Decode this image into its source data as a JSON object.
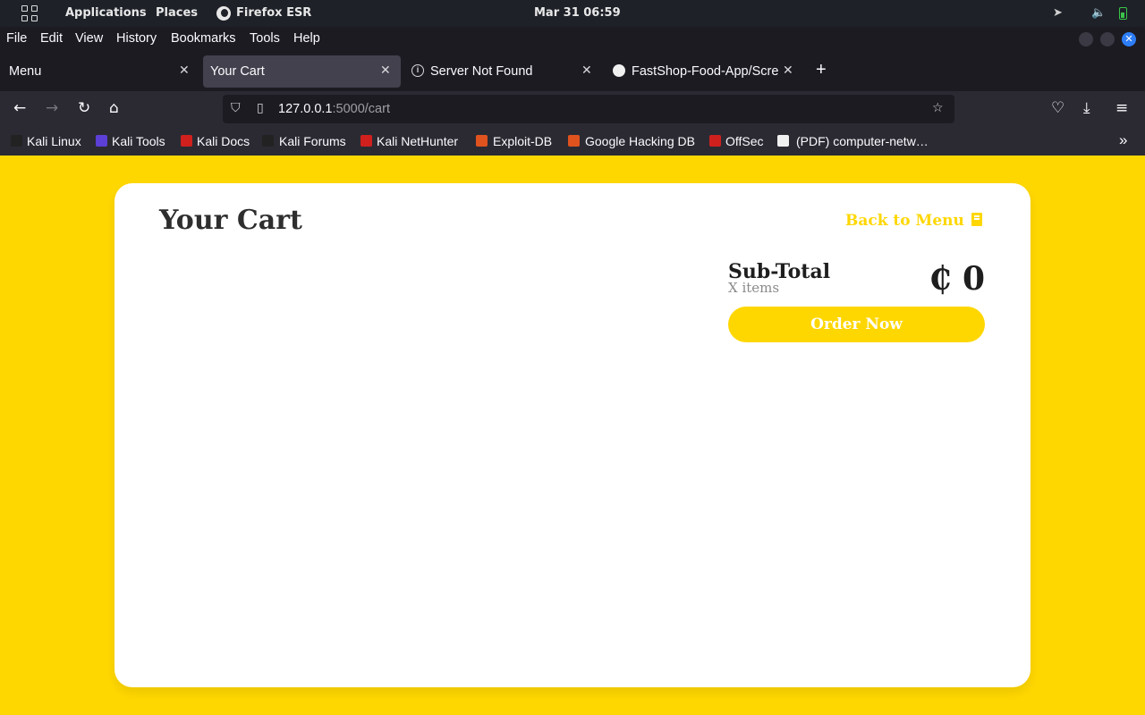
{
  "topbar": {
    "applications": "Applications",
    "places": "Places",
    "browser": "Firefox ESR",
    "clock": "Mar 31  06:59"
  },
  "menubar": {
    "items": [
      "File",
      "Edit",
      "View",
      "History",
      "Bookmarks",
      "Tools",
      "Help"
    ]
  },
  "tabs": [
    {
      "title": "Menu",
      "active": false
    },
    {
      "title": "Your Cart",
      "active": true
    },
    {
      "title": "Server Not Found",
      "active": false
    },
    {
      "title": "FastShop-Food-App/Scre",
      "active": false
    }
  ],
  "urlbar": {
    "host": "127.0.0.1",
    "rest": ":5000/cart"
  },
  "bookmarks": [
    {
      "label": "Kali Linux",
      "color": "#222222"
    },
    {
      "label": "Kali Tools",
      "color": "#5b3fd6"
    },
    {
      "label": "Kali Docs",
      "color": "#d0201e"
    },
    {
      "label": "Kali Forums",
      "color": "#222222"
    },
    {
      "label": "Kali NetHunter",
      "color": "#d0201e"
    },
    {
      "label": "Exploit-DB",
      "color": "#e0521e"
    },
    {
      "label": "Google Hacking DB",
      "color": "#e0521e"
    },
    {
      "label": "OffSec",
      "color": "#d0201e"
    },
    {
      "label": "(PDF) computer-netw…",
      "color": "#f0f0f0"
    }
  ],
  "page": {
    "title": "Your Cart",
    "back_link": "Back to Menu",
    "subtotal_label": "Sub-Total",
    "items_count": "X items",
    "total_amount": "₵ 0",
    "order_button": "Order Now"
  },
  "colors": {
    "accent": "#ffd700",
    "card": "#ffffff",
    "browser_chrome": "#2b2a33"
  }
}
